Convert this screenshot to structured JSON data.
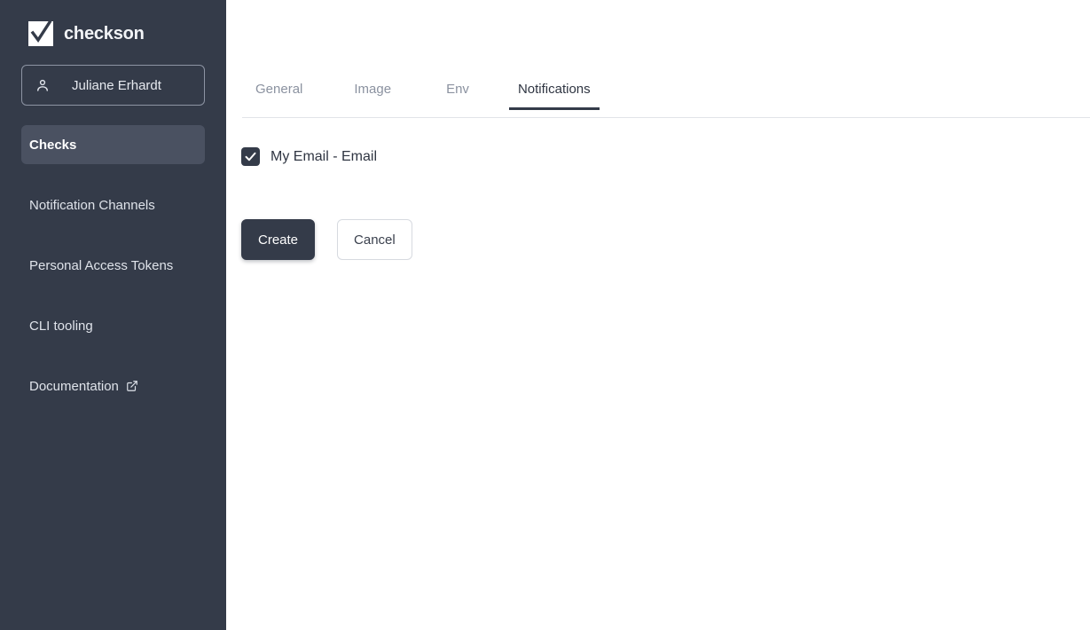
{
  "brand": {
    "name": "checkson",
    "logo_icon": "checkmark-square-icon"
  },
  "sidebar": {
    "user": {
      "name": "Juliane Erhardt",
      "icon": "user-icon"
    },
    "items": [
      {
        "label": "Checks",
        "active": true,
        "external": false
      },
      {
        "label": "Notification Channels",
        "active": false,
        "external": false
      },
      {
        "label": "Personal Access Tokens",
        "active": false,
        "external": false
      },
      {
        "label": "CLI tooling",
        "active": false,
        "external": false
      },
      {
        "label": "Documentation",
        "active": false,
        "external": true,
        "external_icon": "external-link-icon"
      }
    ]
  },
  "main": {
    "tabs": [
      {
        "label": "General",
        "active": false
      },
      {
        "label": "Image",
        "active": false
      },
      {
        "label": "Env",
        "active": false
      },
      {
        "label": "Notifications",
        "active": true
      }
    ],
    "notifications": {
      "channel": {
        "label": "My Email - Email",
        "checked": true,
        "check_icon": "checkmark-icon"
      }
    },
    "actions": {
      "create_label": "Create",
      "cancel_label": "Cancel"
    }
  },
  "colors": {
    "sidebar_bg": "#343b49",
    "sidebar_active_bg": "#4a5161",
    "primary_button_bg": "#343b49",
    "tab_active_underline": "#343b49",
    "tab_inactive_text": "#8b92a0",
    "divider": "#e2e4e8"
  }
}
